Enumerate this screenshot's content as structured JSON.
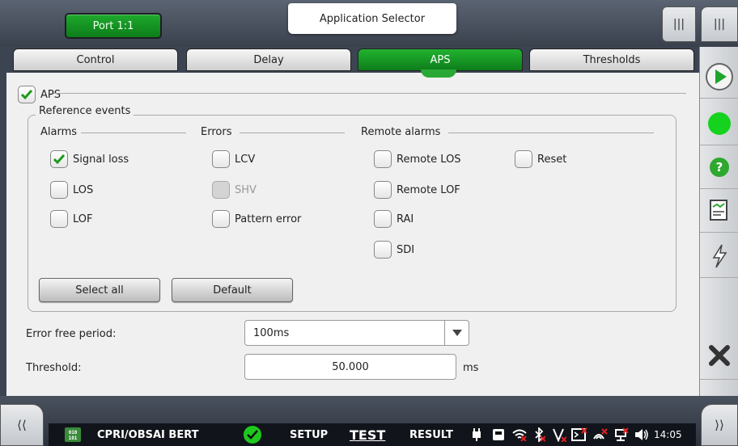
{
  "header": {
    "port_label": "Port 1:1",
    "app_selector_label": "Application Selector",
    "menu_icon_a": "|||",
    "menu_icon_b": "|||"
  },
  "tabs": [
    {
      "label": "Control",
      "active": false
    },
    {
      "label": "Delay",
      "active": false
    },
    {
      "label": "APS",
      "active": true
    },
    {
      "label": "Thresholds",
      "active": false
    }
  ],
  "aps": {
    "label": "APS",
    "checked": true
  },
  "reference_events": {
    "title": "Reference events",
    "alarms": {
      "title": "Alarms",
      "items": [
        {
          "label": "Signal loss",
          "checked": true
        },
        {
          "label": "LOS",
          "checked": false
        },
        {
          "label": "LOF",
          "checked": false
        }
      ]
    },
    "errors": {
      "title": "Errors",
      "items": [
        {
          "label": "LCV",
          "checked": false,
          "disabled": false
        },
        {
          "label": "SHV",
          "checked": false,
          "disabled": true
        },
        {
          "label": "Pattern error",
          "checked": false,
          "disabled": false
        }
      ]
    },
    "remote_alarms": {
      "title": "Remote alarms",
      "items": [
        {
          "label": "Remote LOS",
          "checked": false
        },
        {
          "label": "Remote LOF",
          "checked": false
        },
        {
          "label": "RAI",
          "checked": false
        },
        {
          "label": "SDI",
          "checked": false
        },
        {
          "label": "Reset",
          "checked": false
        }
      ]
    },
    "select_all_label": "Select all",
    "default_label": "Default"
  },
  "error_free_period": {
    "label": "Error free period:",
    "value": "100ms"
  },
  "threshold": {
    "label": "Threshold:",
    "value": "50.000",
    "unit": "ms"
  },
  "statusbar": {
    "app_name": "CPRI/OBSAI BERT",
    "setup": "SETUP",
    "test": "TEST",
    "result": "RESULT",
    "time": "14:05"
  },
  "colors": {
    "accent_green": "#1aa52a",
    "check_green": "#1a9a1a"
  }
}
